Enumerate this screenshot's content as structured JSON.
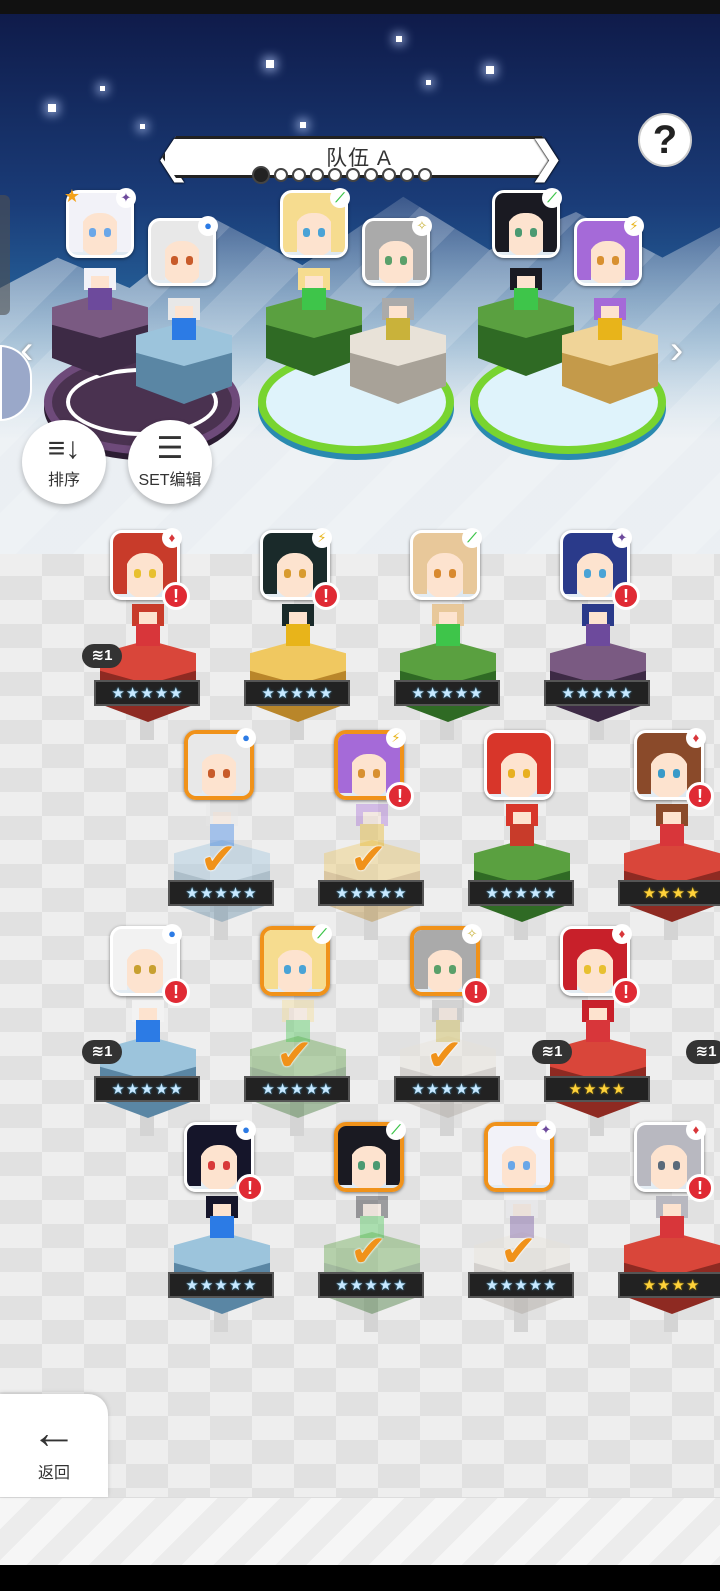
{
  "header": {
    "title": "队伍 A",
    "page_total": 10,
    "page_current": 1
  },
  "buttons": {
    "help": "?",
    "sort": "排序",
    "set_edit": "SET编辑",
    "back": "返回",
    "prev": "‹",
    "next": "›"
  },
  "icons": {
    "sort": "sort-icon",
    "list": "list-icon",
    "back": "back-arrow-icon",
    "help": "question-icon"
  },
  "colors": {
    "selected_border": "#f0921a",
    "alert": "#e02a34",
    "active_ring": "#78d430"
  },
  "team": [
    {
      "slot": 1,
      "ring": "purple",
      "leader": {
        "hair": "#f2f2f8",
        "eyes": "#6aa7e8",
        "elem": "✦",
        "elem_color": "#6d4a9c",
        "star": "★"
      },
      "second": {
        "hair": "#e8e8e8",
        "eyes": "#c85b2a",
        "elem": "●",
        "elem_color": "#2c7be5"
      }
    },
    {
      "slot": 2,
      "ring": "green",
      "leader": {
        "hair": "#f6dc8f",
        "eyes": "#4aa3d6",
        "elem": "⟋",
        "elem_color": "#3ec54a"
      },
      "second": {
        "hair": "#aaaaaa",
        "eyes": "#5aa06a",
        "elem": "✧",
        "elem_color": "#c9b23a"
      }
    },
    {
      "slot": 3,
      "ring": "green",
      "leader": {
        "hair": "#1a1a22",
        "eyes": "#4b9a72",
        "elem": "⟋",
        "elem_color": "#3ec54a"
      },
      "second": {
        "hair": "#a56ad8",
        "eyes": "#d89030",
        "elem": "⚡",
        "elem_color": "#e8b41a"
      }
    }
  ],
  "roster": [
    {
      "hair": "#c83b2a",
      "eyes": "#e8c030",
      "elem": "♦",
      "elem_color": "#d8363a",
      "stars": 5,
      "gold": false,
      "ped": "red",
      "alert": true,
      "used": false,
      "set": "1"
    },
    {
      "hair": "#1a2a2a",
      "eyes": "#d89b30",
      "elem": "⚡",
      "elem_color": "#e8b41a",
      "stars": 5,
      "gold": false,
      "ped": "yellow",
      "alert": true,
      "used": false
    },
    {
      "hair": "#e8c89a",
      "eyes": "#d88a30",
      "elem": "⟋",
      "elem_color": "#3ec54a",
      "stars": 5,
      "gold": false,
      "ped": "green",
      "alert": false,
      "used": false
    },
    {
      "hair": "#2a3a8a",
      "eyes": "#4aa3d6",
      "elem": "✦",
      "elem_color": "#6d4a9c",
      "stars": 5,
      "gold": false,
      "ped": "purple",
      "alert": true,
      "used": false
    },
    {
      "hair": "#e8e8e8",
      "eyes": "#c85b2a",
      "elem": "●",
      "elem_color": "#2c7be5",
      "stars": 5,
      "gold": false,
      "ped": "blue",
      "alert": false,
      "used": true
    },
    {
      "hair": "#a56ad8",
      "eyes": "#d89030",
      "elem": "⚡",
      "elem_color": "#e8b41a",
      "stars": 5,
      "gold": false,
      "ped": "yellow",
      "alert": true,
      "used": true
    },
    {
      "hair": "#d8362a",
      "eyes": "#e8b020",
      "elem": "",
      "elem_color": "#ffffff",
      "stars": 5,
      "gold": false,
      "ped": "green",
      "alert": false,
      "used": false
    },
    {
      "hair": "#8a4a2a",
      "eyes": "#3a9ac8",
      "elem": "♦",
      "elem_color": "#d8363a",
      "stars": 4,
      "gold": true,
      "ped": "red",
      "alert": true,
      "used": false
    },
    {
      "hair": "#f2f2f2",
      "eyes": "#c8a030",
      "elem": "●",
      "elem_color": "#2c7be5",
      "stars": 5,
      "gold": false,
      "ped": "blue",
      "alert": true,
      "used": false,
      "set": "1"
    },
    {
      "hair": "#f6dc8f",
      "eyes": "#4aa3d6",
      "elem": "⟋",
      "elem_color": "#3ec54a",
      "stars": 5,
      "gold": false,
      "ped": "green",
      "alert": false,
      "used": true
    },
    {
      "hair": "#aaaaaa",
      "eyes": "#5aa06a",
      "elem": "✧",
      "elem_color": "#c9b23a",
      "stars": 5,
      "gold": false,
      "ped": "white",
      "alert": true,
      "used": true
    },
    {
      "hair": "#c8202a",
      "eyes": "#e8c030",
      "elem": "♦",
      "elem_color": "#d8363a",
      "stars": 4,
      "gold": true,
      "ped": "red",
      "alert": true,
      "used": false,
      "set": "1"
    },
    {
      "hair": "#15152a",
      "eyes": "#d83a3a",
      "elem": "●",
      "elem_color": "#2c7be5",
      "stars": 5,
      "gold": false,
      "ped": "blue",
      "alert": true,
      "used": false
    },
    {
      "hair": "#1a1a22",
      "eyes": "#4b9a72",
      "elem": "⟋",
      "elem_color": "#3ec54a",
      "stars": 5,
      "gold": false,
      "ped": "green",
      "alert": false,
      "used": true
    },
    {
      "hair": "#f2f2f8",
      "eyes": "#6aa7e8",
      "elem": "✦",
      "elem_color": "#6d4a9c",
      "stars": 5,
      "gold": false,
      "ped": "white",
      "alert": false,
      "used": true
    },
    {
      "hair": "#b8b8c0",
      "eyes": "#5a6a7a",
      "elem": "♦",
      "elem_color": "#d8363a",
      "stars": 4,
      "gold": true,
      "ped": "red",
      "alert": true,
      "used": false
    }
  ],
  "edge_set_badges": [
    {
      "set": "1"
    }
  ]
}
